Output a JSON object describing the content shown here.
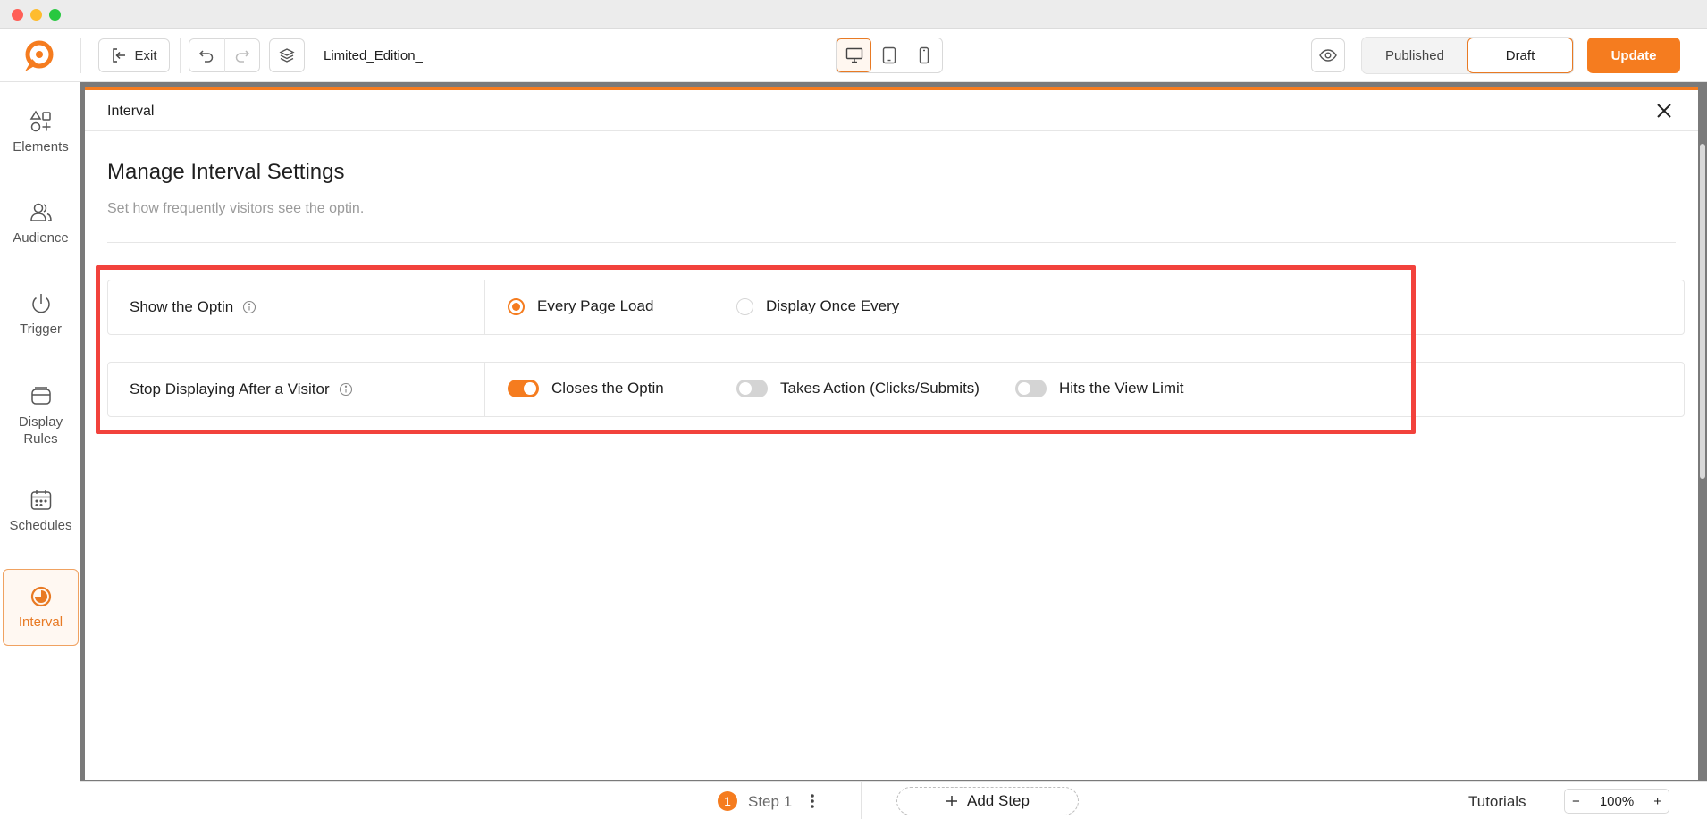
{
  "toolbar": {
    "exit_label": "Exit",
    "doc_title": "Limited_Edition_",
    "status_published": "Published",
    "status_draft": "Draft",
    "update_label": "Update",
    "active_device": "desktop"
  },
  "sidebar": {
    "items": [
      {
        "label": "Elements",
        "icon": "elements-icon"
      },
      {
        "label": "Audience",
        "icon": "audience-icon"
      },
      {
        "label": "Trigger",
        "icon": "power-icon"
      },
      {
        "label": "Display Rules",
        "icon": "display-rules-icon"
      },
      {
        "label": "Schedules",
        "icon": "calendar-icon"
      },
      {
        "label": "Interval",
        "icon": "interval-icon"
      }
    ],
    "active": "Interval"
  },
  "panel": {
    "header_title": "Interval",
    "title": "Manage Interval Settings",
    "subtitle": "Set how frequently visitors see the optin.",
    "rows": [
      {
        "label": "Show the Optin",
        "options": [
          {
            "label": "Every Page Load",
            "type": "radio",
            "checked": true
          },
          {
            "label": "Display Once Every",
            "type": "radio",
            "checked": false
          }
        ]
      },
      {
        "label": "Stop Displaying After a Visitor",
        "options": [
          {
            "label": "Closes the Optin",
            "type": "toggle",
            "checked": true
          },
          {
            "label": "Takes Action (Clicks/Submits)",
            "type": "toggle",
            "checked": false
          },
          {
            "label": "Hits the View Limit",
            "type": "toggle",
            "checked": false
          }
        ]
      }
    ]
  },
  "bottom": {
    "step_number": "1",
    "step_label": "Step 1",
    "add_step_label": "Add Step",
    "tutorials_label": "Tutorials",
    "zoom_minus": "−",
    "zoom_value": "100%",
    "zoom_plus": "+"
  },
  "colors": {
    "accent": "#f57c1f",
    "highlight": "#f2423c"
  }
}
